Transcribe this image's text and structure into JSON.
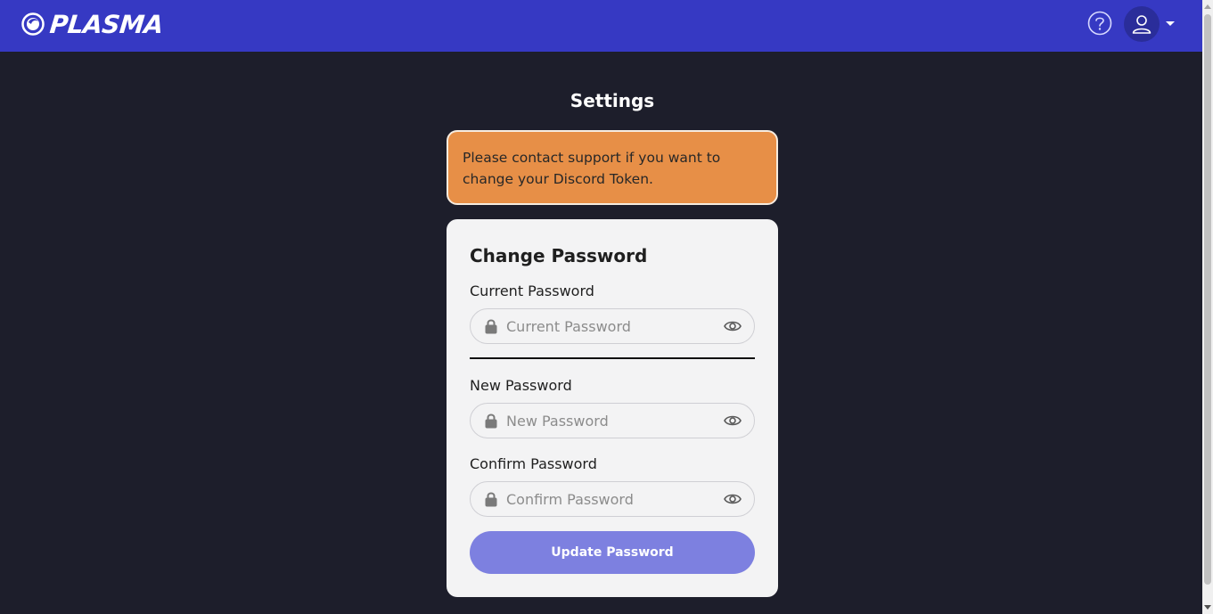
{
  "header": {
    "brand": "PLASMA",
    "icons": {
      "logo": "plasma-logo-icon",
      "help": "help-circle-icon",
      "user": "user-icon",
      "menu": "chevron-down-icon"
    },
    "accent_color": "#3639c3"
  },
  "page": {
    "title": "Settings"
  },
  "notice": {
    "text": "Please contact support if you want to change your Discord Token.",
    "color": "#e78f47"
  },
  "password_form": {
    "title": "Change Password",
    "current": {
      "label": "Current Password",
      "placeholder": "Current Password",
      "value": ""
    },
    "new": {
      "label": "New Password",
      "placeholder": "New Password",
      "value": ""
    },
    "confirm": {
      "label": "Confirm Password",
      "placeholder": "Confirm Password",
      "value": ""
    },
    "submit_label": "Update Password",
    "field_icons": {
      "leading": "lock-icon",
      "trailing": "eye-icon"
    }
  }
}
